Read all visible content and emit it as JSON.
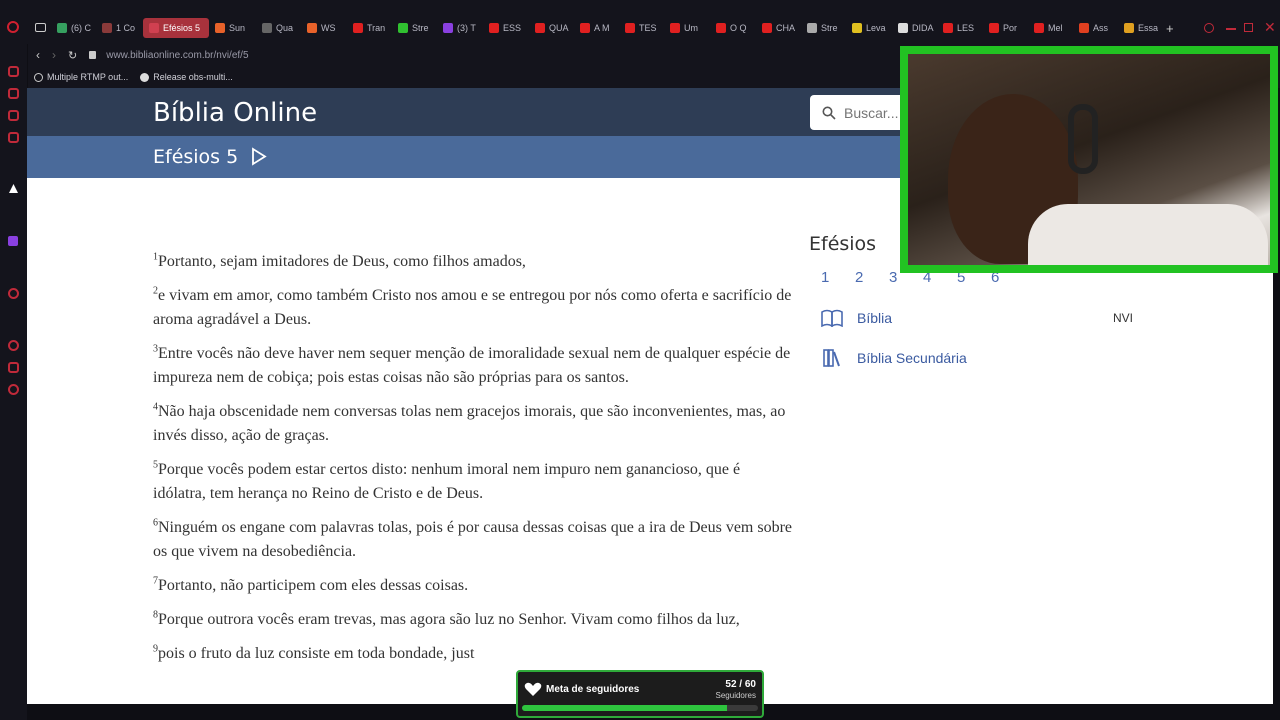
{
  "browser": {
    "tabs": [
      {
        "label": "(6) C",
        "color": "#36a060"
      },
      {
        "label": "1 Co",
        "color": "#8a3a3a"
      },
      {
        "label": "Efésios 5",
        "color": "#d04050",
        "active": true
      },
      {
        "label": "Sun",
        "color": "#e8622a"
      },
      {
        "label": "Qua",
        "color": "#666666"
      },
      {
        "label": "WS",
        "color": "#e8622a"
      },
      {
        "label": "Tran",
        "color": "#e02020"
      },
      {
        "label": "Stre",
        "color": "#30c030"
      },
      {
        "label": "(3) T",
        "color": "#8a40e0"
      },
      {
        "label": "ESS",
        "color": "#e02020"
      },
      {
        "label": "QUA",
        "color": "#e02020"
      },
      {
        "label": "A M",
        "color": "#e02020"
      },
      {
        "label": "TES",
        "color": "#e02020"
      },
      {
        "label": "Um",
        "color": "#e02020"
      },
      {
        "label": "O Q",
        "color": "#e02020"
      },
      {
        "label": "CHA",
        "color": "#e02020"
      },
      {
        "label": "Stre",
        "color": "#aaaaaa"
      },
      {
        "label": "Leva",
        "color": "#e0c020"
      },
      {
        "label": "DIDA",
        "color": "#dddddd"
      },
      {
        "label": "LES",
        "color": "#e02020"
      },
      {
        "label": "Por",
        "color": "#e02020"
      },
      {
        "label": "Mel",
        "color": "#e02020"
      },
      {
        "label": "Ass",
        "color": "#e04020"
      },
      {
        "label": "Essa",
        "color": "#e0a020"
      }
    ],
    "new_tab": "+",
    "url": "www.bibliaonline.com.br/nvi/ef/5",
    "bookmarks": [
      "Multiple RTMP out...",
      "Release obs-multi..."
    ]
  },
  "site": {
    "title": "Bíblia Online",
    "chapter_title": "Efésios 5",
    "search_placeholder": "Buscar..."
  },
  "verses": [
    {
      "num": "1",
      "text": "Portanto, sejam imitadores de Deus, como filhos amados,"
    },
    {
      "num": "2",
      "text": "e vivam em amor, como também Cristo nos amou e se entregou por nós como oferta e sacrifício de aroma agradável a Deus."
    },
    {
      "num": "3",
      "text": "Entre vocês não deve haver nem sequer menção de imoralidade sexual nem de qualquer espécie de impureza nem de cobiça; pois estas coisas não são próprias para os santos."
    },
    {
      "num": "4",
      "text": "Não haja obscenidade nem conversas tolas nem gracejos imorais, que são inconvenientes, mas, ao invés disso, ação de graças."
    },
    {
      "num": "5",
      "text": "Porque vocês podem estar certos disto: nenhum imoral nem impuro nem ganancioso, que é idólatra, tem herança no Reino de Cristo e de Deus."
    },
    {
      "num": "6",
      "text": "Ninguém os engane com palavras tolas, pois é por causa dessas coisas que a ira de Deus vem sobre os que vivem na desobediência."
    },
    {
      "num": "7",
      "text": "Portanto, não participem com eles dessas coisas."
    },
    {
      "num": "8",
      "text": "Porque outrora vocês eram trevas, mas agora são luz no Senhor. Vivam como filhos da luz,"
    },
    {
      "num": "9",
      "text": "pois o fruto da luz consiste em toda bondade, just"
    }
  ],
  "aside": {
    "title": "Efésios",
    "chapters": [
      "1",
      "2",
      "3",
      "4",
      "5",
      "6"
    ],
    "bible_label": "Bíblia",
    "bible_version": "NVI",
    "secondary_label": "Bíblia Secundária"
  },
  "goal": {
    "label": "Meta de seguidores",
    "count": "52 / 60",
    "sub": "Seguidores",
    "progress": 0.8667
  }
}
